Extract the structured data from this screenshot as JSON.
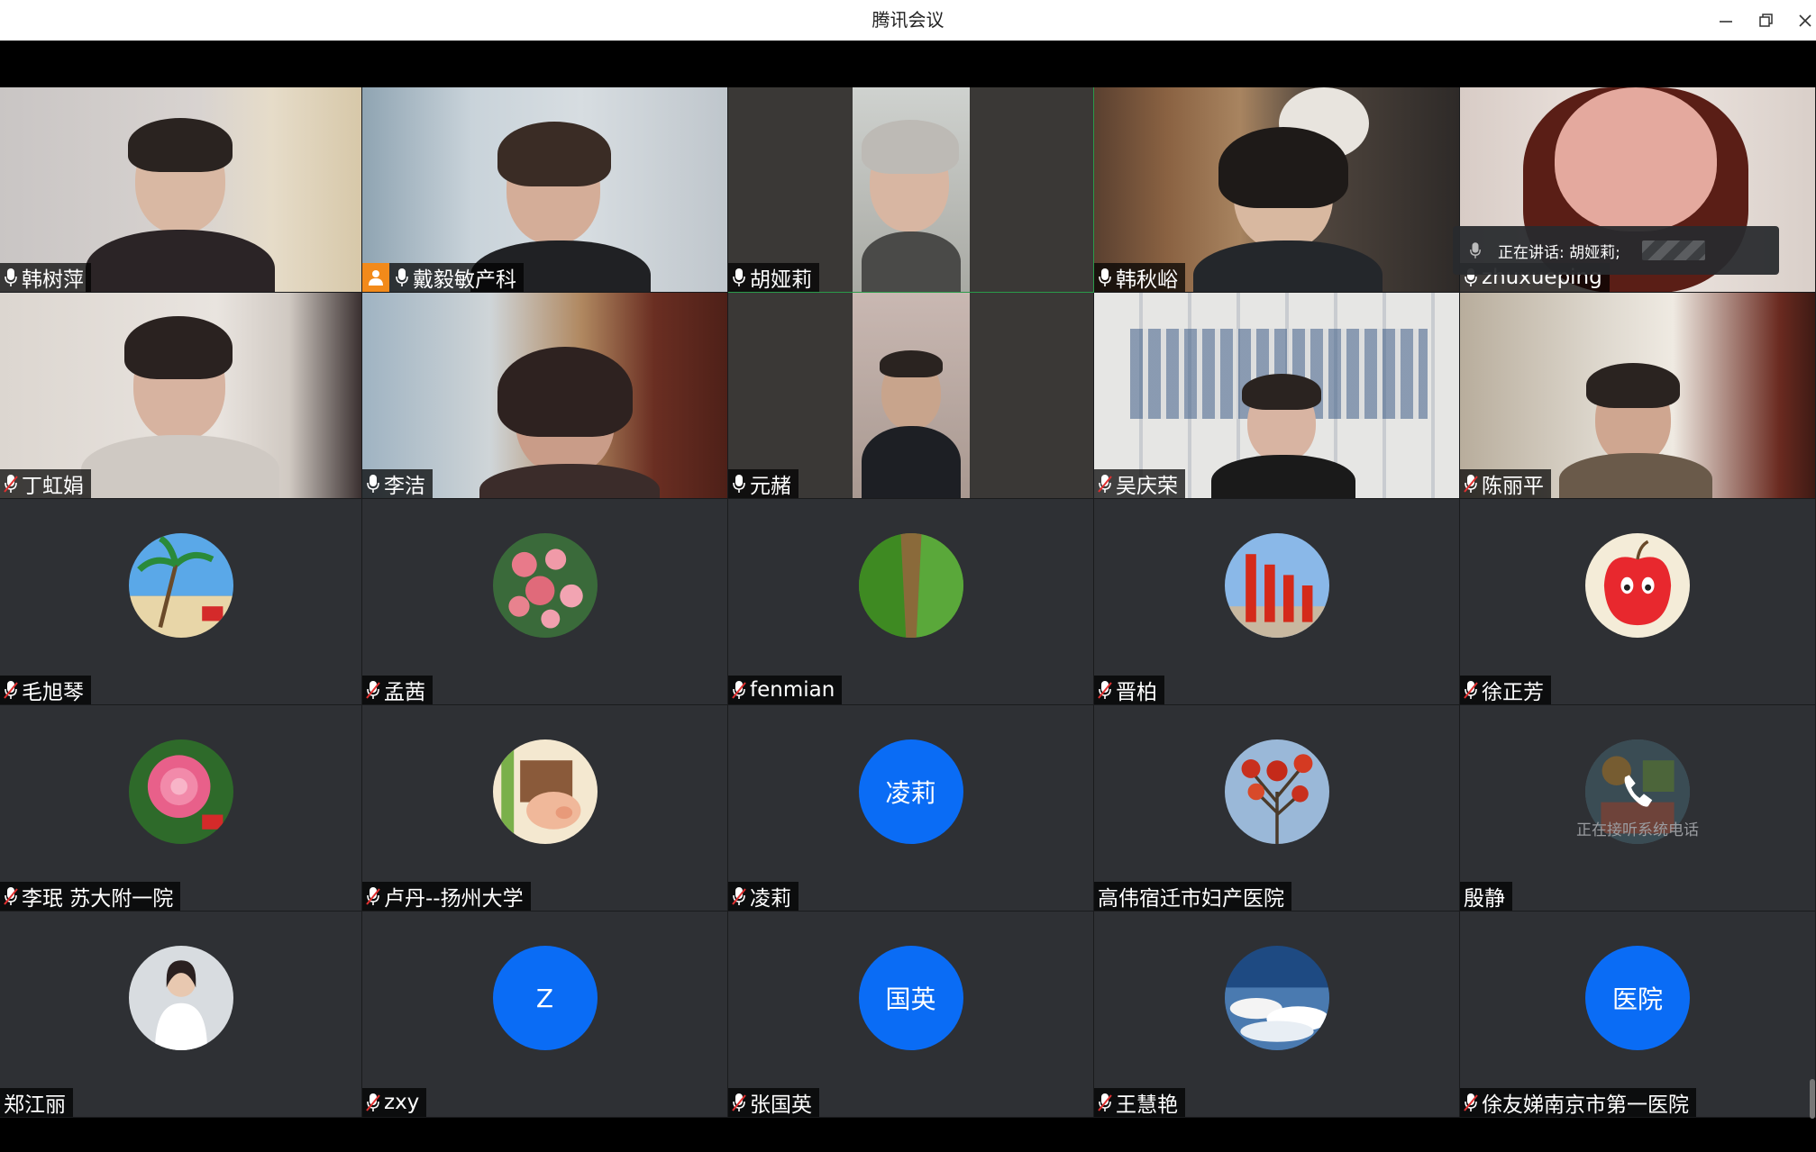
{
  "window": {
    "title": "腾讯会议"
  },
  "speaking": {
    "text": "正在讲话: 胡娅莉;"
  },
  "participants": [
    {
      "name": "韩树萍",
      "mic": "on",
      "kind": "video"
    },
    {
      "name": "戴毅敏产科",
      "mic": "on",
      "kind": "video",
      "host": true
    },
    {
      "name": "胡娅莉",
      "mic": "on",
      "kind": "video",
      "active": true
    },
    {
      "name": "韩秋峪",
      "mic": "on",
      "kind": "video"
    },
    {
      "name": "zhuxueping",
      "mic": "on",
      "kind": "video"
    },
    {
      "name": "丁虹娟",
      "mic": "muted",
      "kind": "video"
    },
    {
      "name": "李洁",
      "mic": "on",
      "kind": "video"
    },
    {
      "name": "元赭",
      "mic": "on",
      "kind": "video"
    },
    {
      "name": "吴庆荣",
      "mic": "muted",
      "kind": "video"
    },
    {
      "name": "陈丽平",
      "mic": "muted",
      "kind": "video"
    },
    {
      "name": "毛旭琴",
      "mic": "muted",
      "kind": "avatar",
      "avatar": "beach-palm-avatar"
    },
    {
      "name": "孟茜",
      "mic": "muted",
      "kind": "avatar",
      "avatar": "pink-flowers-avatar"
    },
    {
      "name": "fenmian",
      "mic": "muted",
      "kind": "avatar",
      "avatar": "green-field-avatar"
    },
    {
      "name": "晋柏",
      "mic": "muted",
      "kind": "avatar",
      "avatar": "red-monument-avatar"
    },
    {
      "name": "徐正芳",
      "mic": "muted",
      "kind": "avatar",
      "avatar": "apple-cartoon-avatar"
    },
    {
      "name": "李珉 苏大附一院",
      "mic": "muted",
      "kind": "avatar",
      "avatar": "peony-avatar"
    },
    {
      "name": "卢丹--扬州大学",
      "mic": "muted",
      "kind": "avatar",
      "avatar": "pig-cartoon-avatar"
    },
    {
      "name": "凌莉",
      "mic": "muted",
      "kind": "avatar",
      "avatar_text": "凌莉"
    },
    {
      "name": "高伟宿迁市妇产医院",
      "mic": "none",
      "kind": "avatar",
      "avatar": "red-tree-avatar"
    },
    {
      "name": "殷静",
      "mic": "none",
      "kind": "phone",
      "avatar": "cartoon-drawing-avatar",
      "caption": "正在接听系统电话"
    },
    {
      "name": "郑江丽",
      "mic": "none",
      "kind": "avatar",
      "avatar": "doctor-portrait-avatar"
    },
    {
      "name": "zxy",
      "mic": "muted",
      "kind": "avatar",
      "avatar_text": "Z"
    },
    {
      "name": "张国英",
      "mic": "muted",
      "kind": "avatar",
      "avatar_text": "国英"
    },
    {
      "name": "王慧艳",
      "mic": "muted",
      "kind": "avatar",
      "avatar": "sky-clouds-avatar"
    },
    {
      "name": "俆友娣南京市第一医院",
      "mic": "muted",
      "kind": "avatar",
      "avatar_text": "医院"
    }
  ]
}
